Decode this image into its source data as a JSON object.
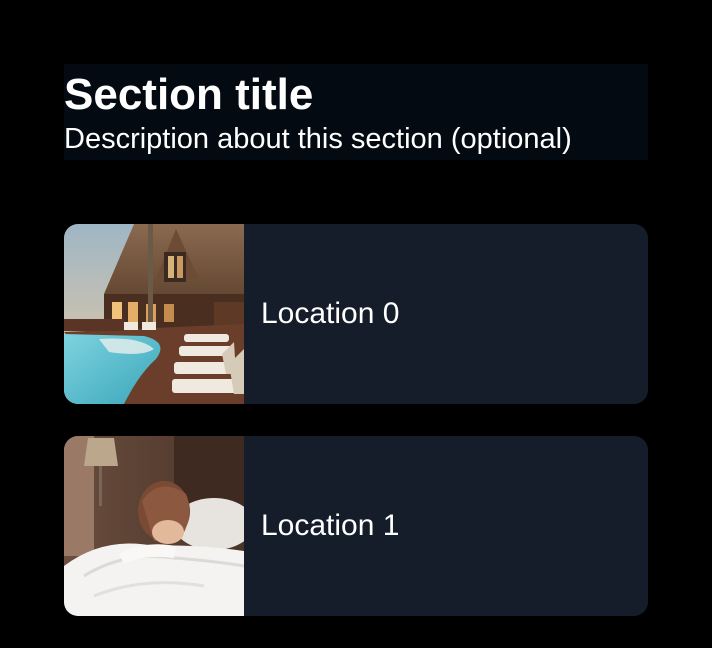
{
  "section": {
    "title": "Section title",
    "description": "Description about this section (optional)"
  },
  "locations": [
    {
      "label": "Location 0",
      "image": "resort-pool-photo"
    },
    {
      "label": "Location 1",
      "image": "person-in-bed-photo"
    }
  ],
  "colors": {
    "background": "#000000",
    "header_background": "#030a12",
    "card_background": "#151c2a",
    "text": "#ffffff"
  }
}
